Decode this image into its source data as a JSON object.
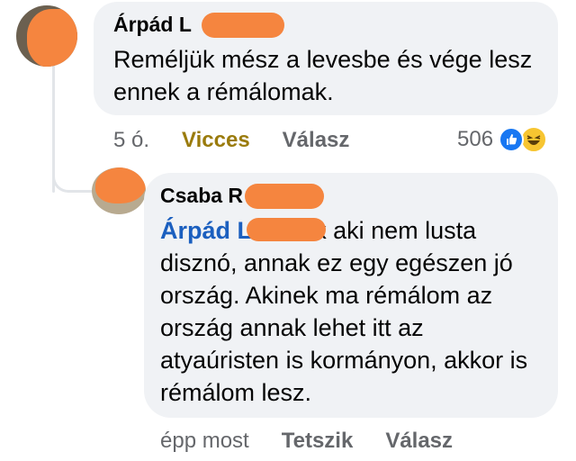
{
  "comment_1": {
    "author": "Árpád L",
    "text": "Reméljük mész a levesbe és vége lesz ennek a rémálomak.",
    "time": "5 ó.",
    "reaction_label": "Vicces",
    "reply_label": "Válasz",
    "reaction_count": "506",
    "reaction_icons": [
      "like-icon",
      "haha-icon"
    ]
  },
  "comment_2": {
    "author": "Csaba R",
    "mention": "Árpád L",
    "text": " Annak aki nem lusta disznó, annak ez egy egészen jó ország. Akinek ma rémálom az ország annak lehet itt az atyaúristen is kormányon, akkor is rémálom lesz.",
    "time": "épp most",
    "like_label": "Tetszik",
    "reply_label": "Válasz"
  },
  "colors": {
    "bubble_bg": "#f0f2f5",
    "mention": "#1b5fbf",
    "meta_text": "#65676b",
    "vicces": "#9a7b0c",
    "redaction": "#f5853f",
    "like_blue": "#1877f2",
    "haha_yellow": "#f7c531"
  }
}
